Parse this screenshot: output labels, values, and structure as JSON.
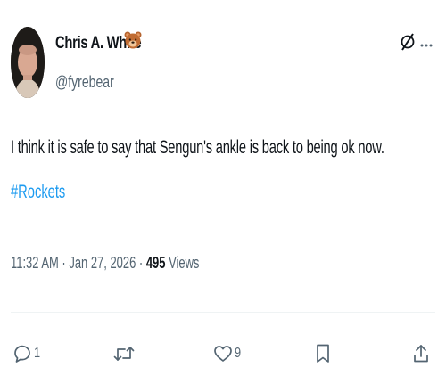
{
  "author": {
    "name": "Chris A. White",
    "handle": "@fyrebear",
    "name_emoji_icon": "bear-face-icon"
  },
  "header_icons": [
    "grok-icon",
    "more-options-icon"
  ],
  "tweet": {
    "text": "I think it is safe to say that Sengun's ankle is back to being ok now.",
    "hashtag": "#Rockets"
  },
  "meta": {
    "time": "11:32 AM",
    "separator": "·",
    "date": "Jan 27, 2026",
    "views_count": "495",
    "views_label": "Views"
  },
  "actions": {
    "reply_count": "1",
    "retweet_count": "",
    "like_count": "9"
  },
  "colors": {
    "link": "#1d9bf0",
    "secondary_text": "#536471",
    "primary_text": "#0f1419",
    "divider": "#eff3f4"
  }
}
